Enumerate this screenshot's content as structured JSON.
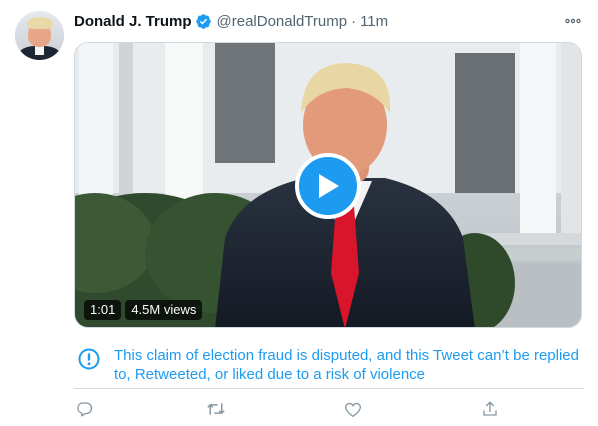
{
  "tweet": {
    "author": {
      "name": "Donald J. Trump",
      "handle": "@realDonaldTrump",
      "verified": true
    },
    "separator": "·",
    "time": "11m",
    "video": {
      "duration": "1:01",
      "views": "4.5M views"
    },
    "notice": {
      "text": "This claim of election fraud is disputed, and this Tweet can’t be replied to, Retweeted, or liked due to a risk of violence"
    }
  },
  "colors": {
    "accent": "#1d9bf0",
    "text_primary": "#0f1419",
    "text_secondary": "#536471",
    "divider": "#cfd9de",
    "action_icon": "#8899a6"
  },
  "icons": {
    "verified": "verified-badge-icon",
    "more": "more-options-icon",
    "play": "play-icon",
    "notice": "exclamation-circle-icon",
    "reply": "reply-icon",
    "retweet": "retweet-icon",
    "like": "heart-icon",
    "share": "share-icon"
  }
}
